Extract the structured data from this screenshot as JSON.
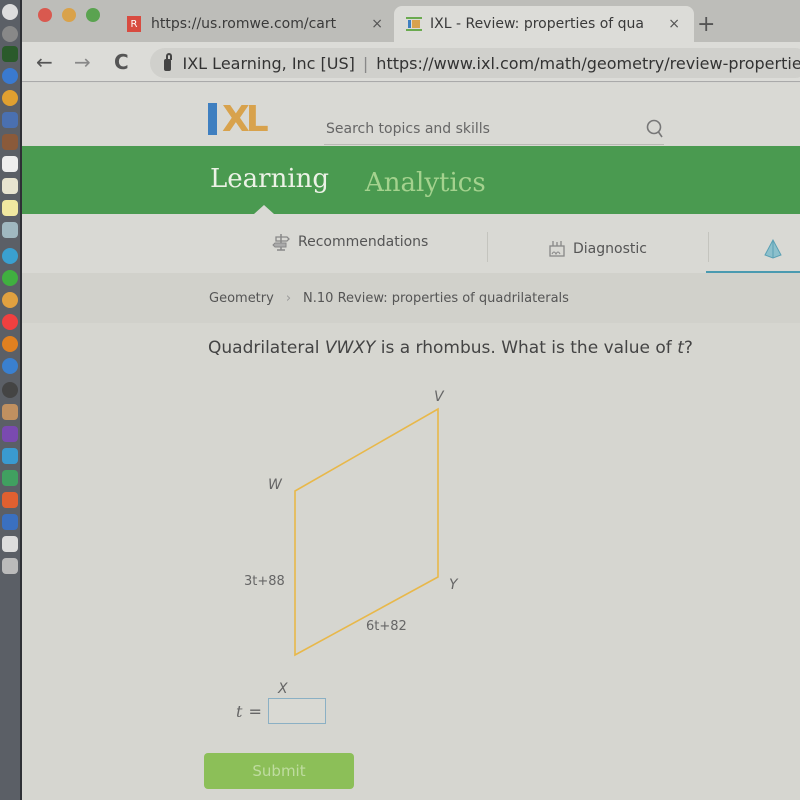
{
  "browser": {
    "tabs": [
      {
        "favicon": "R",
        "title": "https://us.romwe.com/cart",
        "active": false
      },
      {
        "favicon": "IXL",
        "title": "IXL - Review: properties of qua",
        "active": true
      }
    ],
    "tab_close_glyph": "×",
    "new_tab_glyph": "+",
    "nav": {
      "back": "←",
      "forward": "→",
      "reload": "C"
    },
    "address": {
      "org": "IXL Learning, Inc [US]",
      "separator": "|",
      "url": "https://www.ixl.com/math/geometry/review-properties"
    }
  },
  "site": {
    "logo_i": "I",
    "logo_xl": "XL",
    "search_placeholder": "Search topics and skills",
    "main_tabs": [
      {
        "label": "Learning",
        "active": true
      },
      {
        "label": "Analytics",
        "active": false
      }
    ],
    "sub_nav": [
      {
        "label": "Recommendations",
        "icon": "signpost-icon"
      },
      {
        "label": "Diagnostic",
        "icon": "diagnostic-icon"
      },
      {
        "label": "",
        "icon": "pyramid-icon",
        "active": true
      }
    ],
    "breadcrumb": {
      "subject": "Geometry",
      "separator": "›",
      "skill": "N.10 Review: properties of quadrilaterals"
    }
  },
  "problem": {
    "question_prefix": "Quadrilateral ",
    "shape_name": "VWXY",
    "question_middle": " is a rhombus. What is the value of ",
    "variable": "t",
    "question_suffix": "?",
    "vertices": {
      "V": "V",
      "W": "W",
      "X": "X",
      "Y": "Y"
    },
    "side_labels": {
      "WX": "3t+88",
      "XY": "6t+82"
    },
    "shape_color": "#e8b84a",
    "answer": {
      "variable": "t",
      "equals": "=",
      "value": ""
    },
    "submit_label": "Submit"
  },
  "colors": {
    "green_bar": "#4a9a50",
    "submit": "#8cbf58",
    "logo_blue": "#3f7fc0",
    "logo_orange": "#d8a24c",
    "active_underline": "#4a9ab0"
  }
}
